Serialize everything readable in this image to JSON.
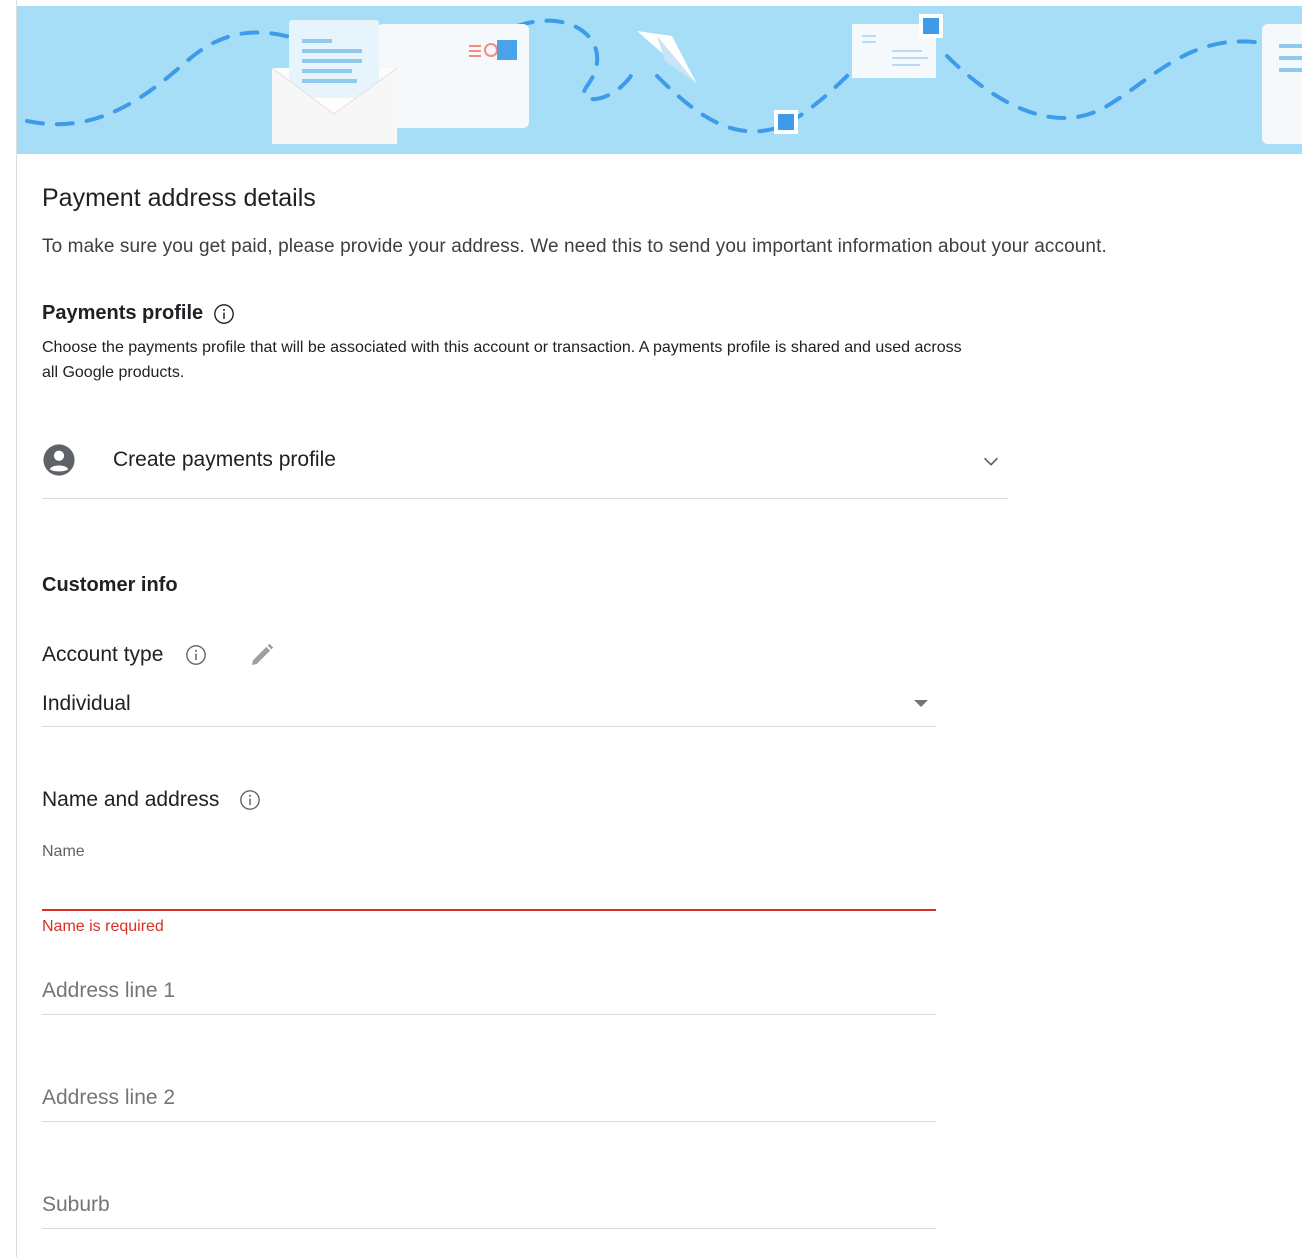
{
  "header": {
    "title": "Payment address details",
    "subtitle": "To make sure you get paid, please provide your address. We need this to send you important information about your account."
  },
  "payments_profile": {
    "heading": "Payments profile",
    "description": "Choose the payments profile that will be associated with this account or transaction. A payments profile is shared and used across all Google products.",
    "selected": "Create payments profile"
  },
  "customer_info": {
    "heading": "Customer info",
    "account_type": {
      "label": "Account type",
      "value": "Individual"
    },
    "name_and_address": {
      "heading": "Name and address",
      "name_label": "Name",
      "name_value": "",
      "name_error": "Name is required",
      "address1_placeholder": "Address line 1",
      "address2_placeholder": "Address line 2",
      "suburb_placeholder": "Suburb"
    }
  },
  "icons": {
    "info": "info-icon",
    "edit": "pencil-icon",
    "avatar": "account-circle-icon",
    "chevron": "chevron-down-icon",
    "caret": "dropdown-caret-icon"
  },
  "colors": {
    "banner": "#a5def6",
    "error": "#d93025",
    "divider": "#dadce0"
  }
}
